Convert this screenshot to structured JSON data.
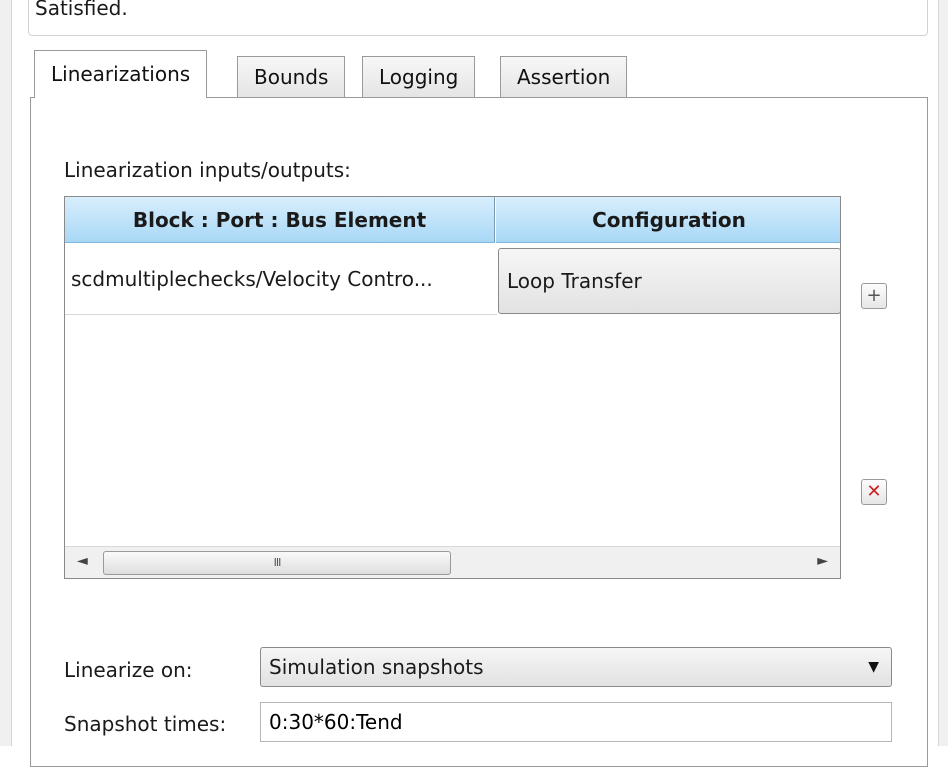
{
  "top_panel": {
    "text": "Satisfied."
  },
  "tabs": [
    {
      "label": "Linearizations",
      "active": true
    },
    {
      "label": "Bounds",
      "active": false
    },
    {
      "label": "Logging",
      "active": false
    },
    {
      "label": "Assertion",
      "active": false
    }
  ],
  "io_section": {
    "label": "Linearization inputs/outputs:",
    "columns": [
      "Block : Port : Bus Element",
      "Configuration"
    ],
    "rows": [
      {
        "block": "scdmultiplechecks/Velocity Contro...",
        "configuration": "Loop Transfer"
      }
    ],
    "scrollbar_grip": "III",
    "add_icon": "plus-icon",
    "remove_icon": "x-icon",
    "remove_color": "#cc2222",
    "header_color": "#a8d8f6"
  },
  "linearize_on": {
    "label": "Linearize on:",
    "value": "Simulation snapshots"
  },
  "snapshot_times": {
    "label": "Snapshot times:",
    "value": "0:30*60:Tend"
  }
}
